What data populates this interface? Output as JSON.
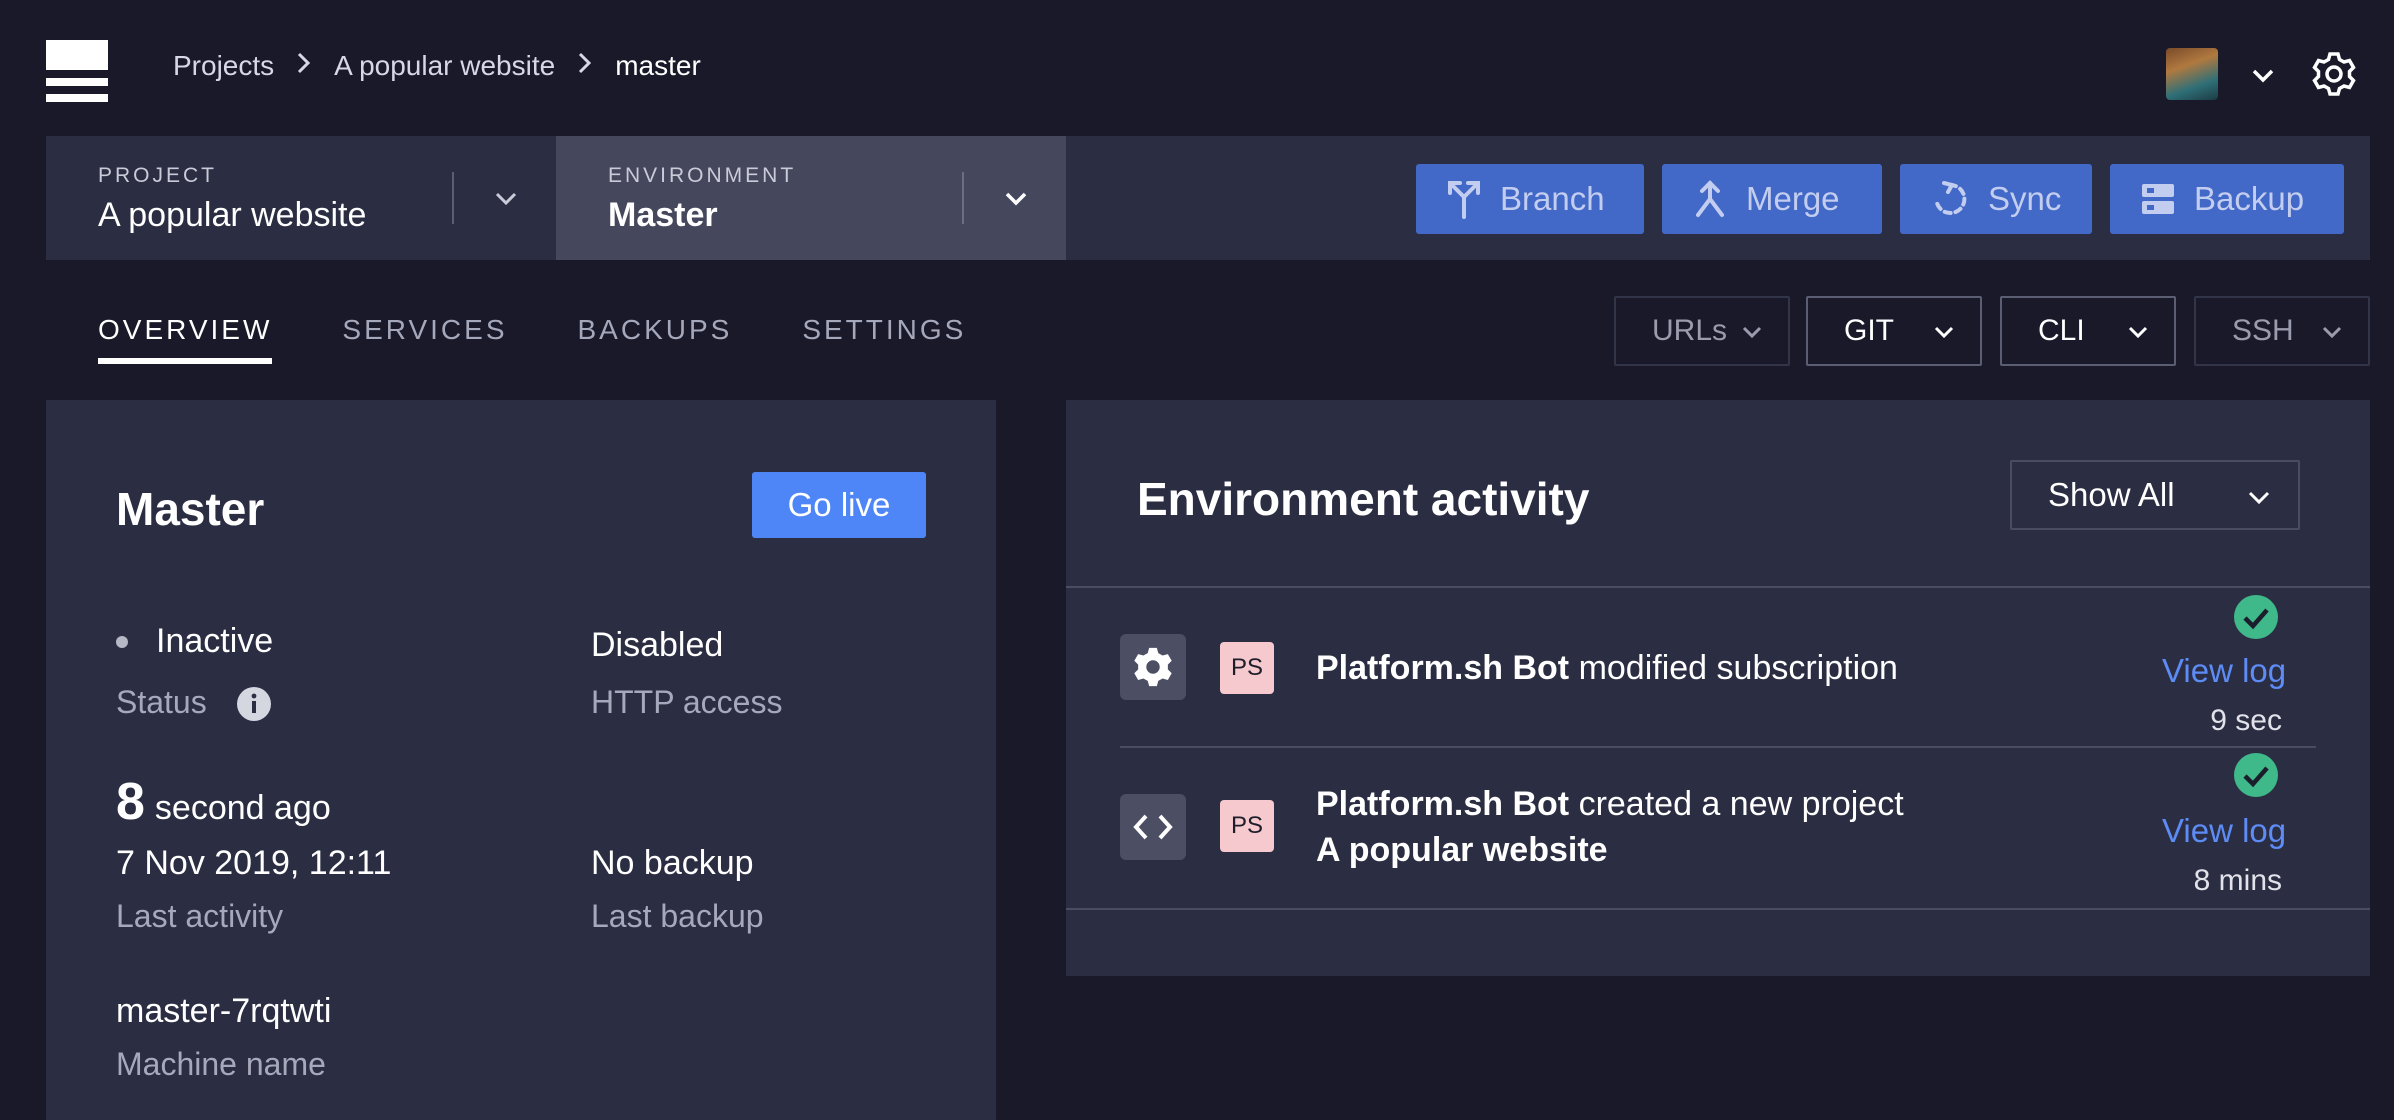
{
  "header": {
    "breadcrumb": [
      "Projects",
      "A popular website",
      "master"
    ],
    "icons": [
      "logo",
      "avatar",
      "chevron-down-icon",
      "gear-icon"
    ]
  },
  "selectors": {
    "project": {
      "label": "PROJECT",
      "value": "A popular website"
    },
    "environment": {
      "label": "ENVIRONMENT",
      "value": "Master"
    }
  },
  "actions": {
    "branch": "Branch",
    "merge": "Merge",
    "sync": "Sync",
    "backup": "Backup"
  },
  "tabs": [
    {
      "label": "OVERVIEW",
      "active": true
    },
    {
      "label": "SERVICES",
      "active": false
    },
    {
      "label": "BACKUPS",
      "active": false
    },
    {
      "label": "SETTINGS",
      "active": false
    }
  ],
  "dropdowns": {
    "urls": "URLs",
    "git": "GIT",
    "cli": "CLI",
    "ssh": "SSH"
  },
  "overview": {
    "title": "Master",
    "go_live": "Go live",
    "status_value": "Inactive",
    "status_label": "Status",
    "http_value": "Disabled",
    "http_label": "HTTP access",
    "activity_number": "8",
    "activity_unit": "second ago",
    "activity_date": "7 Nov 2019, 12:11",
    "activity_label": "Last activity",
    "backup_value": "No backup",
    "backup_label": "Last backup",
    "machine_value": "master-7rqtwti",
    "machine_label": "Machine name"
  },
  "activity": {
    "title": "Environment activity",
    "filter": "Show All",
    "items": [
      {
        "icon": "gear-icon",
        "badge": "PS",
        "actor": "Platform.sh Bot",
        "action": "modified subscription",
        "target": "",
        "link": "View log",
        "time": "9 sec",
        "status": "success"
      },
      {
        "icon": "code-icon",
        "badge": "PS",
        "actor": "Platform.sh Bot",
        "action": "created a new project",
        "target": "A popular website",
        "link": "View log",
        "time": "8 mins",
        "status": "success"
      }
    ]
  },
  "colors": {
    "background": "#191929",
    "panel": "#2b2d42",
    "env_selected": "#45485d",
    "action_button": "#4268c8",
    "primary": "#4f86f7",
    "link": "#5d8cf6",
    "success": "#3fb88a",
    "badge": "#f6c9cf"
  }
}
